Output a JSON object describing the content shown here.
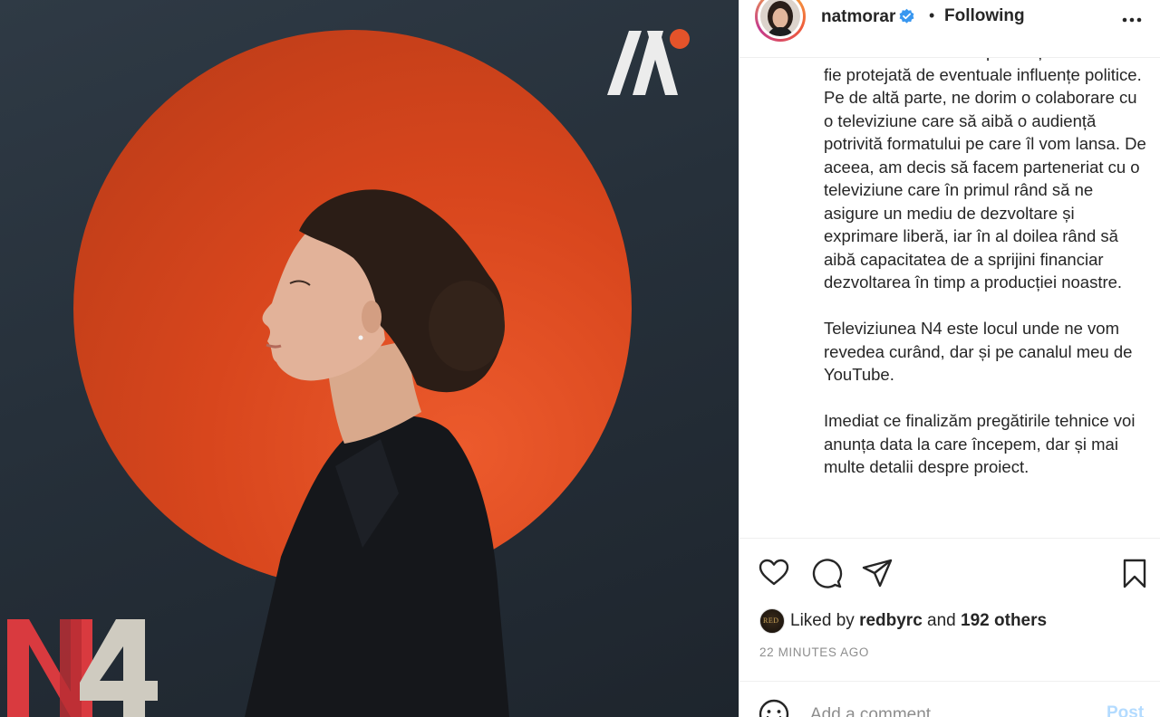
{
  "post": {
    "username": "natmorar",
    "separator": "•",
    "follow_status": "Following",
    "caption_paragraphs": [
      "cu o televiziune unde producția noastră să fie protejată de eventuale influențe politice. Pe de altă parte, ne dorim o colaborare cu o televiziune care să aibă o audiență potrivită formatului pe care îl vom lansa. De aceea, am decis să facem parteneriat cu o televiziune care în primul rând să ne asigure un mediu de dezvoltare și exprimare liberă, iar în al doilea rând să aibă capacitatea de a sprijini financiar dezvoltarea în timp a producției noastre.",
      "Televiziunea N4 este locul unde ne vom revedea curând, dar și pe canalul meu de YouTube.",
      "Imediat ce finalizăm pregătirile tehnice voi anunța data la care începem, dar și mai multe detalii despre proiect."
    ],
    "likes": {
      "prefix": "Liked by",
      "liker": "redbyrc",
      "connector": "and",
      "others": "192 others",
      "liker_avatar_text": "RED"
    },
    "timestamp": "22 MINUTES AGO",
    "comment": {
      "placeholder": "Add a comment...",
      "post_label": "Post"
    }
  },
  "image": {
    "bottom_logo_text": "N4"
  },
  "icons": {
    "verified": "verified-badge-icon",
    "more": "more-options-icon",
    "like": "heart-icon",
    "comment": "comment-bubble-icon",
    "share": "paper-plane-icon",
    "save": "bookmark-icon",
    "emoji": "smiley-icon"
  },
  "colors": {
    "accent_orange": "#e4532a",
    "verified_blue": "#3897f0",
    "post_button_disabled": "#b3dbff",
    "muted_text": "#8e8e8e"
  }
}
